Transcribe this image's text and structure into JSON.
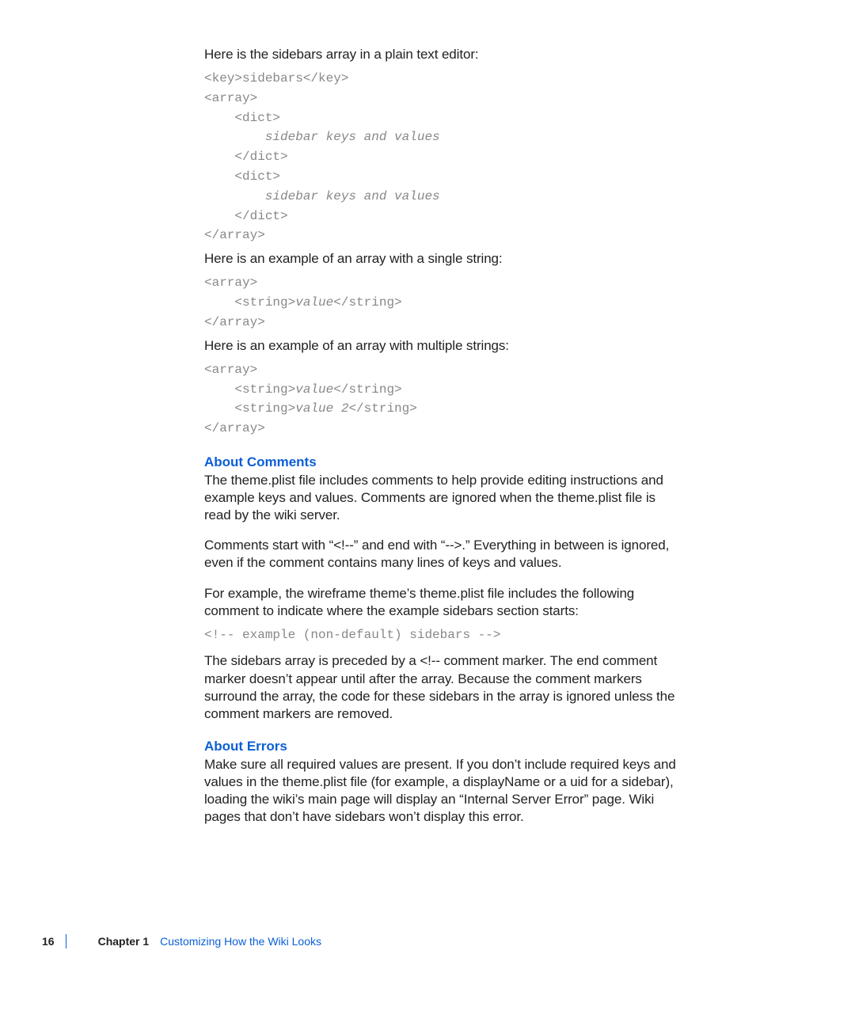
{
  "intro1": "Here is the sidebars array in a plain text editor:",
  "code1_l1": "<key>sidebars</key>",
  "code1_l2": "<array>",
  "code1_l3": "    <dict>",
  "code1_l4": "        sidebar keys and values",
  "code1_l5": "    </dict>",
  "code1_l6": "    <dict>",
  "code1_l7": "        sidebar keys and values",
  "code1_l8": "    </dict>",
  "code1_l9": "</array>",
  "intro2": "Here is an example of an array with a single string:",
  "code2_l1": "<array>",
  "code2_l2a": "    <string>",
  "code2_l2b": "value",
  "code2_l2c": "</string>",
  "code2_l3": "</array>",
  "intro3": "Here is an example of an array with multiple strings:",
  "code3_l1": "<array>",
  "code3_l2a": "    <string>",
  "code3_l2b": "value",
  "code3_l2c": "</string>",
  "code3_l3a": "    <string>",
  "code3_l3b": "value 2",
  "code3_l3c": "</string>",
  "code3_l4": "</array>",
  "h_comments": "About Comments",
  "p_comments1": "The theme.plist file includes comments to help provide editing instructions and example keys and values. Comments are ignored when the theme.plist file is read by the wiki server.",
  "p_comments2": "Comments start with “<!--” and end with “-->.” Everything in between is ignored, even if the comment contains many lines of keys and values.",
  "p_comments3": "For example, the wireframe theme’s theme.plist file includes the following comment to indicate where the example sidebars section starts:",
  "code4": "<!-- example (non-default) sidebars -->",
  "p_comments4": "The sidebars array is preceded by a <!-- comment marker. The end comment marker doesn’t appear until after the array. Because the comment markers surround the array, the code for these sidebars in the array is ignored unless the comment markers are removed.",
  "h_errors": "About Errors",
  "p_errors1": "Make sure all required values are present. If you don’t include required keys and values in the theme.plist file (for example, a displayName or a uid for a sidebar), loading the wiki’s main page will display an “Internal Server Error” page. Wiki pages that don’t have sidebars won’t display this error.",
  "footer": {
    "page": "16",
    "chapter_label": "Chapter 1",
    "chapter_title": "Customizing How the Wiki Looks"
  }
}
